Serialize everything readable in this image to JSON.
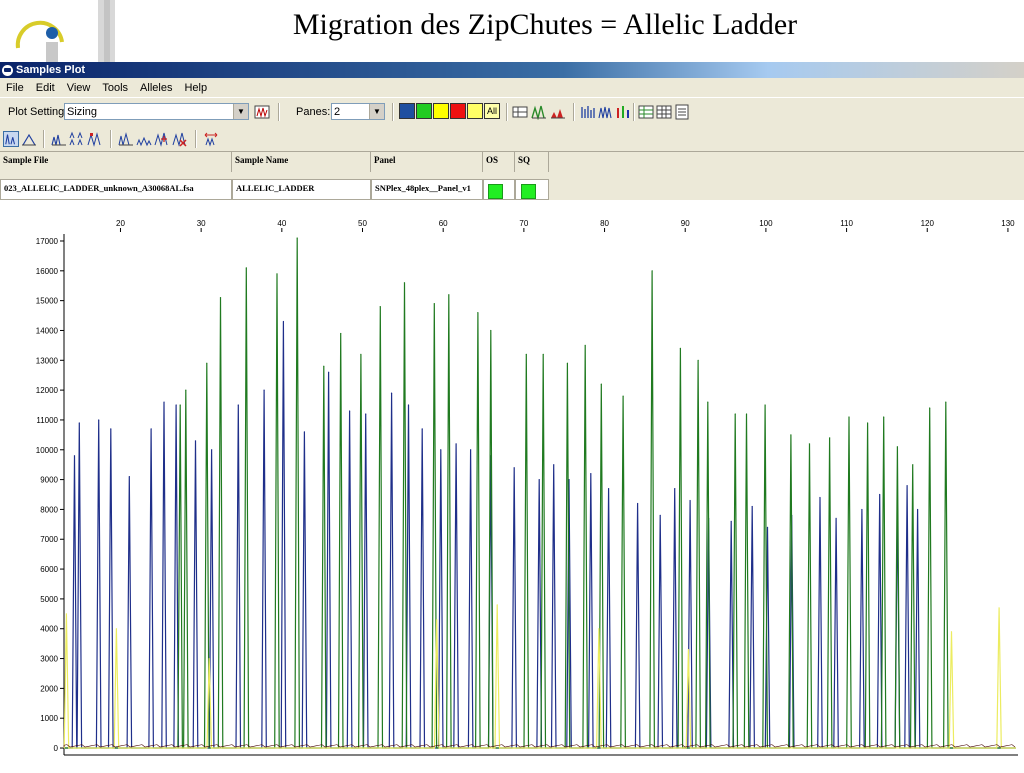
{
  "slide": {
    "title": "Migration des ZipChutes = Allelic Ladder"
  },
  "window": {
    "title": "Samples Plot"
  },
  "menu": [
    "File",
    "Edit",
    "View",
    "Tools",
    "Alleles",
    "Help"
  ],
  "toolbar": {
    "plot_setting_label": "Plot Setting:",
    "plot_setting_value": "Sizing",
    "panes_label": "Panes:",
    "panes_value": "2",
    "all_label": "All",
    "color_buttons": [
      "#1f4fa0",
      "#22cc22",
      "#ffff00",
      "#ee1111",
      "#ffff66"
    ]
  },
  "table": {
    "headers": [
      "Sample File",
      "Sample Name",
      "Panel",
      "OS",
      "SQ"
    ],
    "rows": [
      {
        "sample_file": "023_ALLELIC_LADDER_unknown_A30068AL.fsa",
        "sample_name": "ALLELIC_LADDER",
        "panel": "SNPlex_48plex__Panel_v1",
        "os_color": "#22ee22",
        "sq_color": "#22ee22"
      }
    ]
  },
  "chart_data": {
    "type": "line",
    "x_ticks": [
      20,
      30,
      40,
      50,
      60,
      70,
      80,
      90,
      100,
      110,
      120,
      130
    ],
    "y_ticks": [
      0,
      1000,
      2000,
      3000,
      4000,
      5000,
      6000,
      7000,
      8000,
      9000,
      10000,
      11000,
      12000,
      13000,
      14000,
      15000,
      16000,
      17000
    ],
    "xlim": [
      13,
      131
    ],
    "ylim": [
      -200,
      17100
    ],
    "series": [
      {
        "color": "#1f2f8a",
        "peaks": [
          [
            14.3,
            9800
          ],
          [
            14.9,
            10900
          ],
          [
            17.3,
            11000
          ],
          [
            18.8,
            10700
          ],
          [
            21.1,
            9100
          ],
          [
            23.8,
            10700
          ],
          [
            25.4,
            11600
          ],
          [
            26.9,
            11500
          ],
          [
            29.3,
            10300
          ],
          [
            31.3,
            10000
          ],
          [
            34.6,
            11500
          ],
          [
            37.8,
            12000
          ],
          [
            40.2,
            14300
          ],
          [
            42.8,
            10600
          ],
          [
            45.8,
            12600
          ],
          [
            48.4,
            11300
          ],
          [
            50.4,
            11200
          ],
          [
            53.6,
            11900
          ],
          [
            55.7,
            11500
          ],
          [
            57.4,
            10700
          ],
          [
            59.7,
            10000
          ],
          [
            61.6,
            10200
          ],
          [
            63.4,
            10000
          ],
          [
            65.9,
            9800
          ],
          [
            68.8,
            9400
          ],
          [
            71.9,
            9000
          ],
          [
            73.7,
            9500
          ],
          [
            75.6,
            9000
          ],
          [
            78.3,
            9200
          ],
          [
            80.5,
            8700
          ],
          [
            84.1,
            8200
          ],
          [
            86.9,
            7800
          ],
          [
            88.7,
            8700
          ],
          [
            90.6,
            8300
          ],
          [
            92.9,
            7700
          ],
          [
            95.7,
            7600
          ],
          [
            98.3,
            8100
          ],
          [
            100.2,
            7400
          ],
          [
            103.2,
            7800
          ],
          [
            106.7,
            8400
          ],
          [
            108.7,
            7700
          ],
          [
            111.9,
            8000
          ],
          [
            114.1,
            8500
          ],
          [
            116.3,
            8200
          ],
          [
            117.5,
            8800
          ],
          [
            118.8,
            8000
          ]
        ]
      },
      {
        "color": "#207a20",
        "peaks": [
          [
            27.4,
            11500
          ],
          [
            28.1,
            12000
          ],
          [
            30.7,
            12900
          ],
          [
            32.4,
            15100
          ],
          [
            35.6,
            16100
          ],
          [
            39.4,
            15900
          ],
          [
            41.9,
            17100
          ],
          [
            45.2,
            12800
          ],
          [
            47.3,
            13900
          ],
          [
            49.8,
            13200
          ],
          [
            52.2,
            14800
          ],
          [
            55.2,
            15600
          ],
          [
            58.9,
            14900
          ],
          [
            60.7,
            15200
          ],
          [
            64.3,
            14600
          ],
          [
            65.9,
            14000
          ],
          [
            70.3,
            13200
          ],
          [
            72.4,
            13200
          ],
          [
            75.4,
            12900
          ],
          [
            77.6,
            13500
          ],
          [
            79.6,
            12200
          ],
          [
            82.3,
            11800
          ],
          [
            85.9,
            16000
          ],
          [
            89.4,
            13400
          ],
          [
            91.6,
            13000
          ],
          [
            92.8,
            11600
          ],
          [
            96.2,
            11200
          ],
          [
            97.6,
            11200
          ],
          [
            99.9,
            11500
          ],
          [
            103.1,
            10500
          ],
          [
            105.4,
            10200
          ],
          [
            107.9,
            10400
          ],
          [
            110.3,
            11100
          ],
          [
            112.6,
            10900
          ],
          [
            114.6,
            11100
          ],
          [
            116.3,
            10100
          ],
          [
            118.2,
            9500
          ],
          [
            120.3,
            11400
          ],
          [
            122.3,
            11600
          ]
        ]
      },
      {
        "color": "#ecec60",
        "peaks": [
          [
            13.3,
            4500
          ],
          [
            19.5,
            4000
          ],
          [
            31.0,
            3000
          ],
          [
            59.2,
            4300
          ],
          [
            66.7,
            4800
          ],
          [
            79.3,
            4000
          ],
          [
            90.4,
            3300
          ],
          [
            123.0,
            3900
          ],
          [
            128.9,
            4700
          ]
        ]
      }
    ]
  }
}
